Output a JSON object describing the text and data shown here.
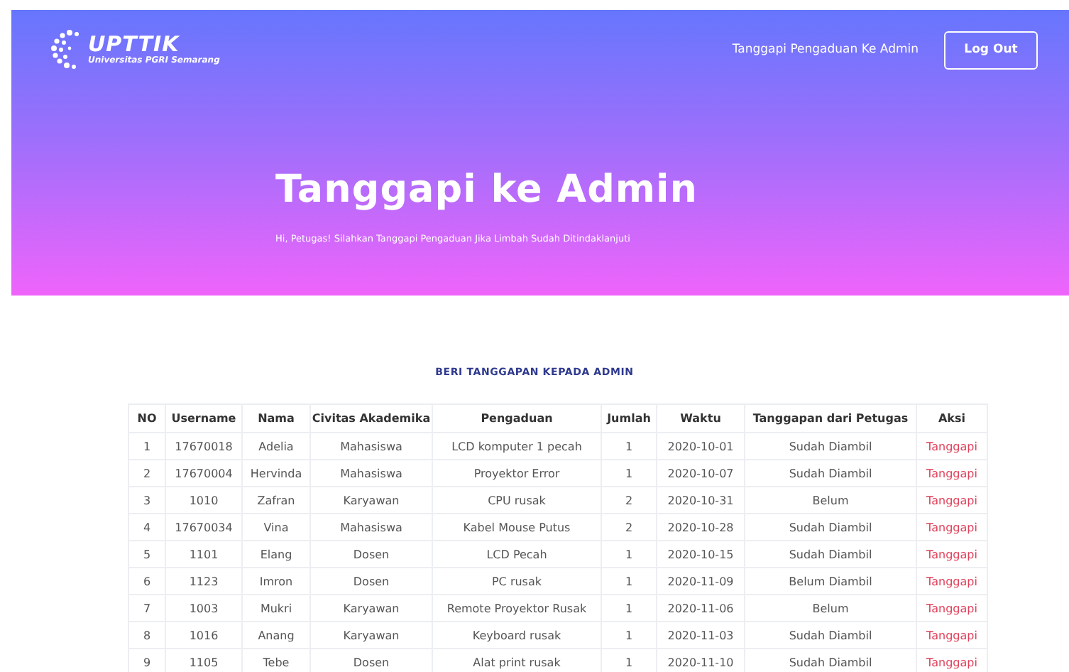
{
  "logo": {
    "name": "UPTTIK",
    "subtitle": "Universitas PGRI Semarang"
  },
  "nav": {
    "link": "Tanggapi Pengaduan Ke Admin",
    "button": "Log Out"
  },
  "hero": {
    "title": "Tanggapi ke Admin",
    "subtitle": "Hi, Petugas! Silahkan Tanggapi Pengaduan Jika Limbah Sudah Ditindaklanjuti"
  },
  "section_title": "BERI TANGGAPAN KEPADA ADMIN",
  "table": {
    "columns": [
      "NO",
      "Username",
      "Nama",
      "Civitas Akademika",
      "Pengaduan",
      "Jumlah",
      "Waktu",
      "Tanggapan dari Petugas",
      "Aksi"
    ],
    "rows": [
      [
        "1",
        "17670018",
        "Adelia",
        "Mahasiswa",
        "LCD komputer 1 pecah",
        "1",
        "2020-10-01",
        "Sudah Diambil",
        "Tanggapi"
      ],
      [
        "2",
        "17670004",
        "Hervinda",
        "Mahasiswa",
        "Proyektor Error",
        "1",
        "2020-10-07",
        "Sudah Diambil",
        "Tanggapi"
      ],
      [
        "3",
        "1010",
        "Zafran",
        "Karyawan",
        "CPU rusak",
        "2",
        "2020-10-31",
        "Belum",
        "Tanggapi"
      ],
      [
        "4",
        "17670034",
        "Vina",
        "Mahasiswa",
        "Kabel Mouse Putus",
        "2",
        "2020-10-28",
        "Sudah Diambil",
        "Tanggapi"
      ],
      [
        "5",
        "1101",
        "Elang",
        "Dosen",
        "LCD Pecah",
        "1",
        "2020-10-15",
        "Sudah Diambil",
        "Tanggapi"
      ],
      [
        "6",
        "1123",
        "Imron",
        "Dosen",
        "PC rusak",
        "1",
        "2020-11-09",
        "Belum Diambil",
        "Tanggapi"
      ],
      [
        "7",
        "1003",
        "Mukri",
        "Karyawan",
        "Remote Proyektor Rusak",
        "1",
        "2020-11-06",
        "Belum",
        "Tanggapi"
      ],
      [
        "8",
        "1016",
        "Anang",
        "Karyawan",
        "Keyboard rusak",
        "1",
        "2020-11-03",
        "Sudah Diambil",
        "Tanggapi"
      ],
      [
        "9",
        "1105",
        "Tebe",
        "Dosen",
        "Alat print rusak",
        "1",
        "2020-11-10",
        "Sudah Diambil",
        "Tanggapi"
      ]
    ]
  }
}
